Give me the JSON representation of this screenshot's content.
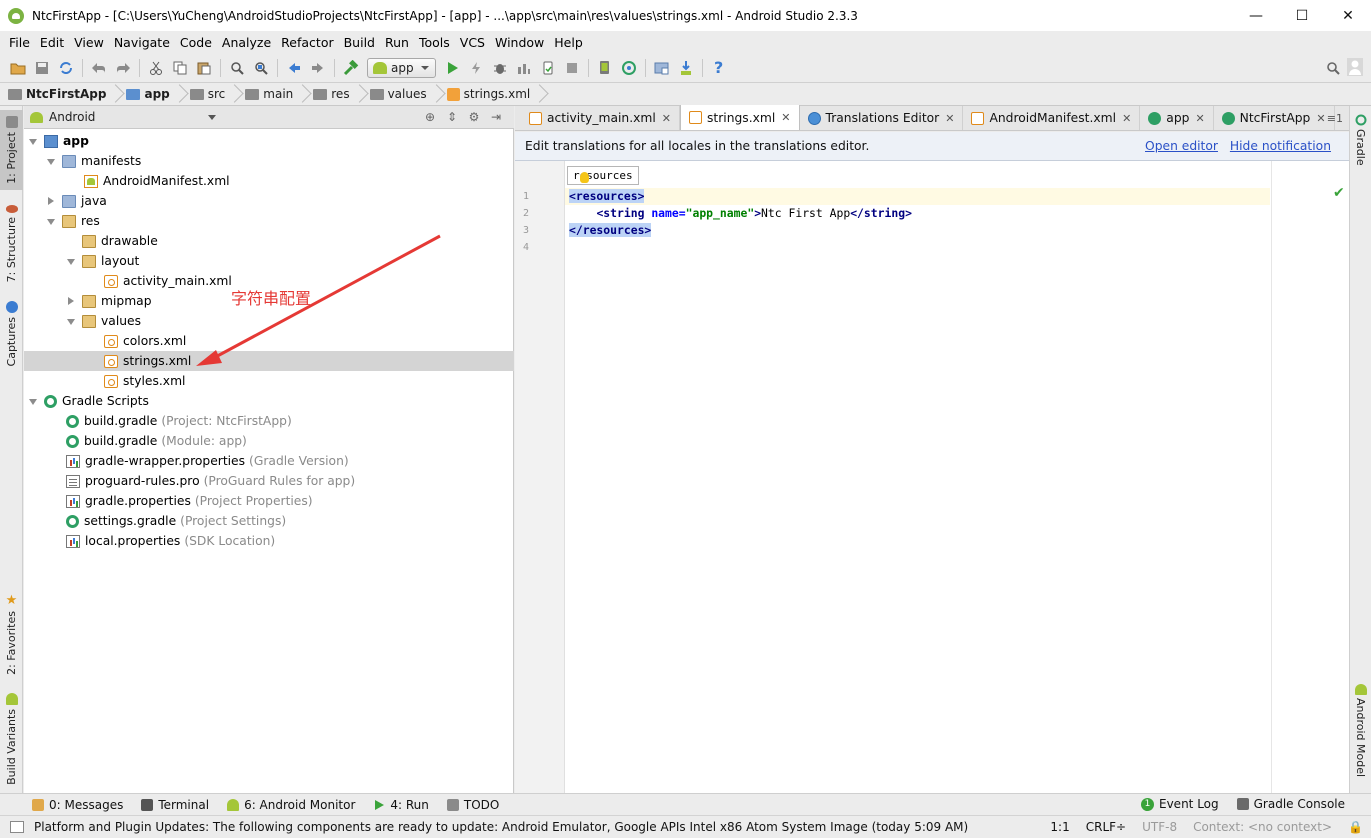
{
  "window": {
    "title": "NtcFirstApp - [C:\\Users\\YuCheng\\AndroidStudioProjects\\NtcFirstApp] - [app] - ...\\app\\src\\main\\res\\values\\strings.xml - Android Studio 2.3.3",
    "minimize": "—",
    "maximize": "☐",
    "close": "✕"
  },
  "menu": [
    "File",
    "Edit",
    "View",
    "Navigate",
    "Code",
    "Analyze",
    "Refactor",
    "Build",
    "Run",
    "Tools",
    "VCS",
    "Window",
    "Help"
  ],
  "toolbar": {
    "run_config": "app",
    "help": "?"
  },
  "breadcrumb": [
    "NtcFirstApp",
    "app",
    "src",
    "main",
    "res",
    "values",
    "strings.xml"
  ],
  "left_tabs": {
    "project": "1: Project",
    "structure": "7: Structure",
    "captures": "Captures",
    "favorites": "2: Favorites",
    "build_variants": "Build Variants"
  },
  "right_tabs": {
    "gradle": "Gradle",
    "android_model": "Android Model"
  },
  "project_panel": {
    "view_mode": "Android"
  },
  "tree": [
    {
      "label": "app",
      "hint": "",
      "bold": true
    },
    {
      "label": "manifests",
      "hint": ""
    },
    {
      "label": "AndroidManifest.xml",
      "hint": ""
    },
    {
      "label": "java",
      "hint": ""
    },
    {
      "label": "res",
      "hint": ""
    },
    {
      "label": "drawable",
      "hint": ""
    },
    {
      "label": "layout",
      "hint": ""
    },
    {
      "label": "activity_main.xml",
      "hint": ""
    },
    {
      "label": "mipmap",
      "hint": ""
    },
    {
      "label": "values",
      "hint": ""
    },
    {
      "label": "colors.xml",
      "hint": ""
    },
    {
      "label": "strings.xml",
      "hint": ""
    },
    {
      "label": "styles.xml",
      "hint": ""
    },
    {
      "label": "Gradle Scripts",
      "hint": ""
    },
    {
      "label": "build.gradle",
      "hint": "(Project: NtcFirstApp)"
    },
    {
      "label": "build.gradle",
      "hint": "(Module: app)"
    },
    {
      "label": "gradle-wrapper.properties",
      "hint": "(Gradle Version)"
    },
    {
      "label": "proguard-rules.pro",
      "hint": "(ProGuard Rules for app)"
    },
    {
      "label": "gradle.properties",
      "hint": "(Project Properties)"
    },
    {
      "label": "settings.gradle",
      "hint": "(Project Settings)"
    },
    {
      "label": "local.properties",
      "hint": "(SDK Location)"
    }
  ],
  "annotation": "字符串配置",
  "editor_tabs": [
    "activity_main.xml",
    "strings.xml",
    "Translations Editor",
    "AndroidManifest.xml",
    "app",
    "NtcFirstApp"
  ],
  "tab_overflow": "≡1",
  "notification": {
    "text": "Edit translations for all locales in the translations editor.",
    "open_editor": "Open editor",
    "hide_notification": "Hide notification"
  },
  "editor": {
    "tooltip": "resources",
    "line_numbers": [
      "1",
      "2",
      "3",
      "4"
    ],
    "line1_tag": "<resources>",
    "line2_indent": "    ",
    "line2_open": "<string ",
    "line2_attr": "name=",
    "line2_val": "\"app_name\"",
    "line2_gt": ">",
    "line2_text": "Ntc First App",
    "line2_close": "</string>",
    "line3_tag": "</resources>"
  },
  "bottom_tools": {
    "messages": "0: Messages",
    "terminal": "Terminal",
    "android_monitor": "6: Android Monitor",
    "run": "4: Run",
    "todo": "TODO",
    "event_log_count": "1",
    "event_log": "Event Log",
    "gradle_console": "Gradle Console"
  },
  "status": {
    "message": "Platform and Plugin Updates: The following components are ready to update: Android Emulator, Google APIs Intel x86 Atom System Image (today 5:09 AM)",
    "position": "1:1",
    "line_sep": "CRLF÷",
    "encoding": "UTF-8",
    "context": "Context: <no context>"
  },
  "colors": {
    "annotation_red": "#e53935",
    "link_blue": "#2b51c7",
    "xml_tag": "#000080",
    "xml_attr": "#0000ff",
    "xml_value": "#008000",
    "selection": "#bcd3f6"
  }
}
